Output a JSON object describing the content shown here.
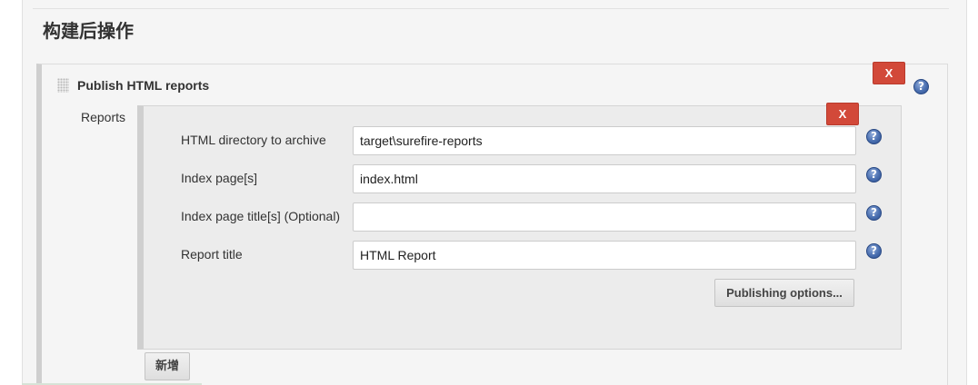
{
  "section": {
    "title": "构建后操作"
  },
  "publisher": {
    "title": "Publish HTML reports",
    "delete_label": "X",
    "help_glyph": "?"
  },
  "reports": {
    "label": "Reports",
    "delete_label": "X",
    "fields": [
      {
        "label": "HTML directory to archive",
        "value": "target\\surefire-reports",
        "help_glyph": "?"
      },
      {
        "label": "Index page[s]",
        "value": "index.html",
        "help_glyph": "?"
      },
      {
        "label": "Index page title[s] (Optional)",
        "value": "",
        "help_glyph": "?"
      },
      {
        "label": "Report title",
        "value": "HTML Report",
        "help_glyph": "?"
      }
    ],
    "publishing_options_label": "Publishing options...",
    "add_label": "新增"
  },
  "colors": {
    "delete_button": "#d24939",
    "help_icon": "#4a6fb0",
    "panel_background": "#f5f5f5"
  }
}
